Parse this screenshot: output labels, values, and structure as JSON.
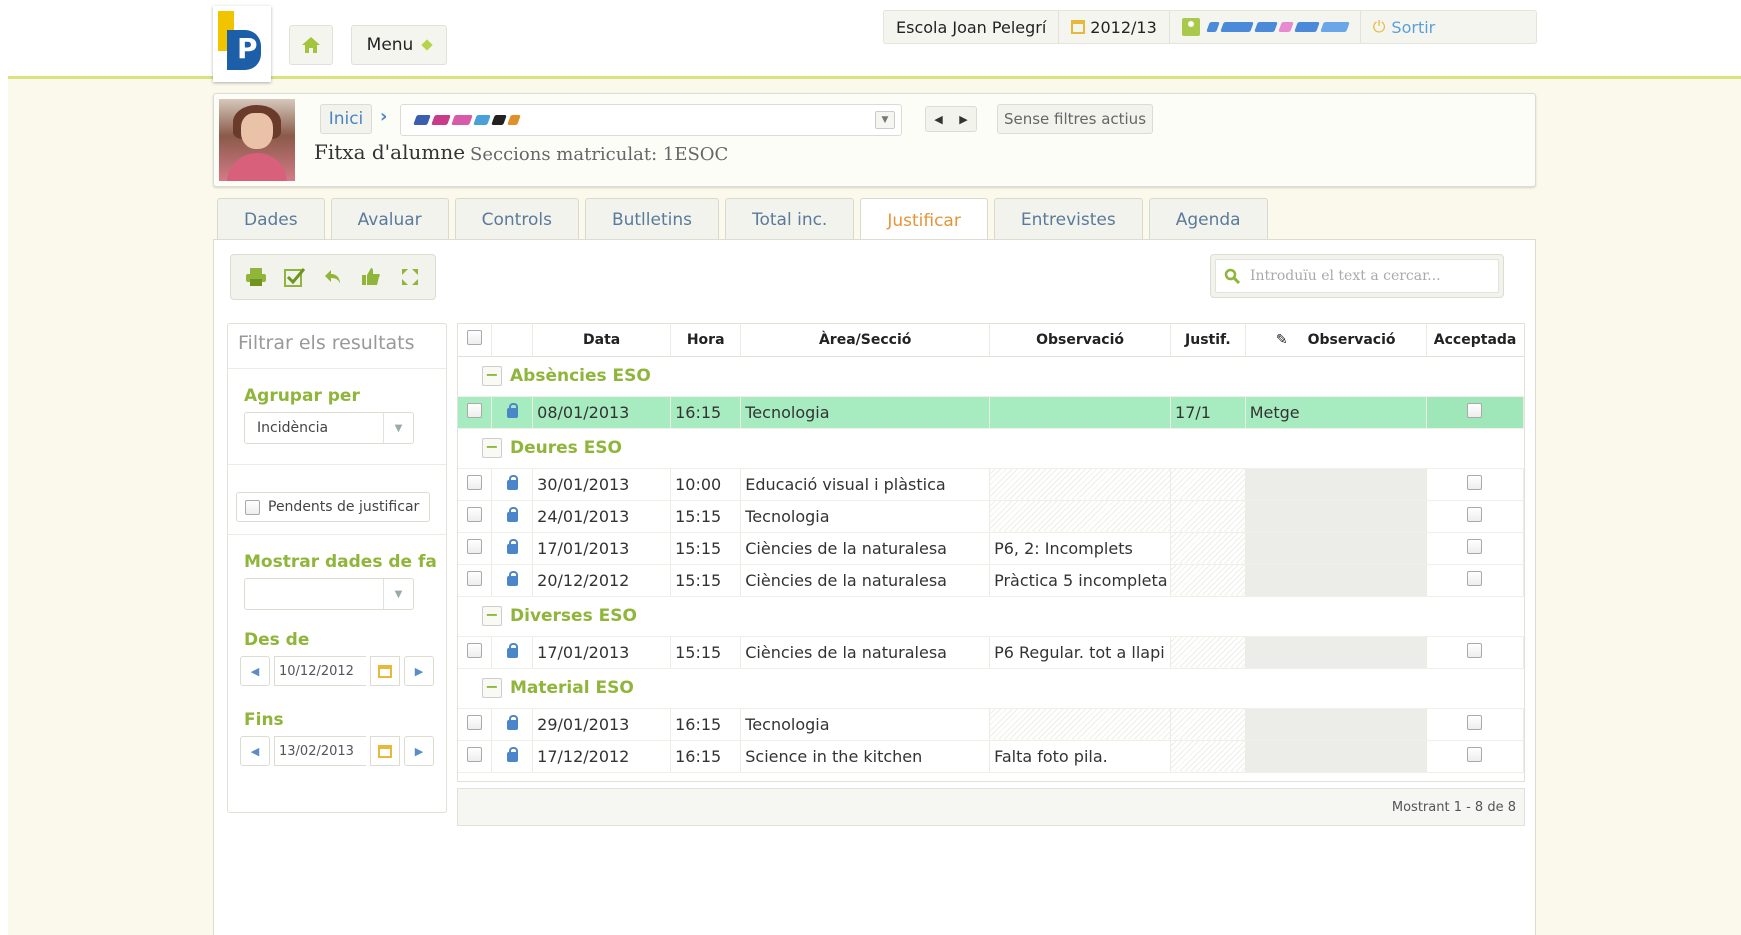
{
  "header": {
    "menu_label": "Menu",
    "school_name": "Escola Joan Pelegrí",
    "school_year": "2012/13",
    "logout_label": "Sortir",
    "brand_color": "#8fb53a",
    "accent_color": "#e79436"
  },
  "student": {
    "breadcrumb_home": "Inici",
    "filters_label": "Sense filtres actius",
    "title": "Fitxa d'alumne",
    "sections": "Seccions matriculat: 1ESOC"
  },
  "tabs": [
    {
      "label": "Dades"
    },
    {
      "label": "Avaluar"
    },
    {
      "label": "Controls"
    },
    {
      "label": "Butlletins"
    },
    {
      "label": "Total inc."
    },
    {
      "label": "Justificar",
      "active": true
    },
    {
      "label": "Entrevistes"
    },
    {
      "label": "Agenda"
    }
  ],
  "toolbar": {
    "icons": [
      "print-icon",
      "check-icon",
      "undo-icon",
      "thumbs-up-icon",
      "expand-icon"
    ]
  },
  "search": {
    "placeholder": "Introduïu el text a cercar..."
  },
  "filters": {
    "title": "Filtrar els resultats",
    "group_label": "Agrupar per",
    "group_value": "Incidència",
    "pending_label": "Pendents de justificar",
    "show_label": "Mostrar dades de fa",
    "show_value": "",
    "from_label": "Des de",
    "from_value": "10/12/2012",
    "to_label": "Fins",
    "to_value": "13/02/2013"
  },
  "table": {
    "columns": {
      "data": "Data",
      "hora": "Hora",
      "area": "Àrea/Secció",
      "obs": "Observació",
      "justif": "Justif.",
      "obs2": "Observació",
      "accepted": "Acceptada"
    },
    "groups": [
      {
        "name": "Absències ESO",
        "rows": [
          {
            "date": "08/01/2013",
            "time": "16:15",
            "area": "Tecnologia",
            "obs": "",
            "justif": "17/1",
            "obs2": "Metge",
            "highlighted": true
          }
        ]
      },
      {
        "name": "Deures ESO",
        "rows": [
          {
            "date": "30/01/2013",
            "time": "10:00",
            "area": "Educació visual i plàstica",
            "obs": "",
            "justif": "",
            "obs2": ""
          },
          {
            "date": "24/01/2013",
            "time": "15:15",
            "area": "Tecnologia",
            "obs": "",
            "justif": "",
            "obs2": ""
          },
          {
            "date": "17/01/2013",
            "time": "15:15",
            "area": "Ciències de la naturalesa",
            "obs": "P6, 2: Incomplets",
            "justif": "",
            "obs2": ""
          },
          {
            "date": "20/12/2012",
            "time": "15:15",
            "area": "Ciències de la naturalesa",
            "obs": "Pràctica 5 incompleta",
            "justif": "",
            "obs2": ""
          }
        ]
      },
      {
        "name": "Diverses  ESO",
        "rows": [
          {
            "date": "17/01/2013",
            "time": "15:15",
            "area": "Ciències de la naturalesa",
            "obs": "P6 Regular. tot a llapi",
            "justif": "",
            "obs2": ""
          }
        ]
      },
      {
        "name": "Material ESO",
        "rows": [
          {
            "date": "29/01/2013",
            "time": "16:15",
            "area": "Tecnologia",
            "obs": "",
            "justif": "",
            "obs2": ""
          },
          {
            "date": "17/12/2012",
            "time": "16:15",
            "area": "Science in the kitchen",
            "obs": "Falta foto pila.",
            "justif": "",
            "obs2": ""
          }
        ]
      }
    ],
    "footer": "Mostrant 1 - 8 de 8"
  }
}
